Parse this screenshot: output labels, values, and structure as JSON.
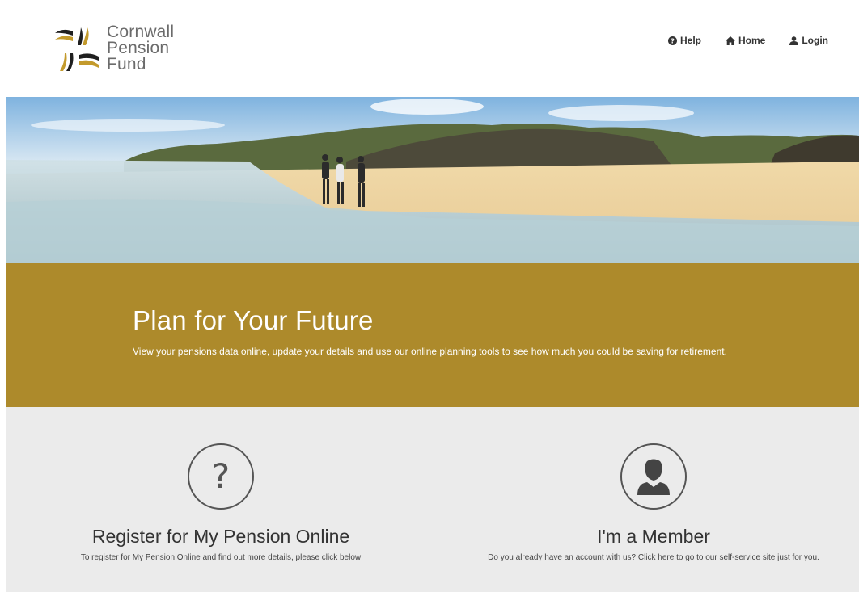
{
  "header": {
    "logo": {
      "line1": "Cornwall",
      "line2": "Pension",
      "line3": "Fund"
    },
    "nav": {
      "help": "Help",
      "home": "Home",
      "login": "Login"
    }
  },
  "hero_band": {
    "title": "Plan for Your Future",
    "text": "View your pensions data online, update your details and use our online planning tools to see how much you could be saving for retirement."
  },
  "cards": {
    "register": {
      "icon_glyph": "?",
      "title": "Register for My Pension Online",
      "text": "To register for My Pension Online and find out more details, please click below"
    },
    "member": {
      "title": "I'm a Member",
      "text": "Do you already have an account with us? Click here to go to our self-service site just for you."
    }
  },
  "colors": {
    "gold": "#ad8a2b",
    "panel": "#ebebeb"
  }
}
